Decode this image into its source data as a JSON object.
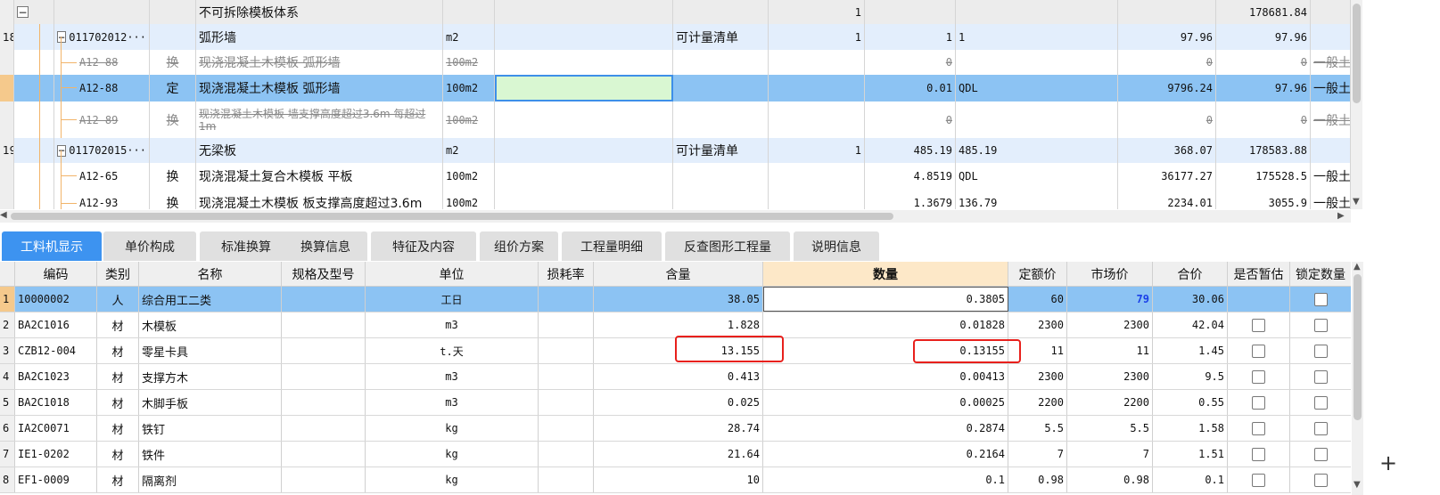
{
  "upper": {
    "rows": [
      {
        "no": "",
        "code": "",
        "code_tree": "minus",
        "type": "",
        "name": "不可拆除模板体系",
        "unit": "",
        "main_label": "",
        "fdl": "1",
        "qty1": "",
        "qty2": "",
        "price": "",
        "total": "178681.84",
        "kind": "",
        "style": "parent",
        "strike": false
      },
      {
        "no": "18",
        "code": "011702012···",
        "code_tree": "minus",
        "type": "",
        "name": "弧形墙",
        "unit": "m2",
        "main_label": "可计量清单",
        "fdl": "1",
        "qty1": "1",
        "qty2": "1",
        "price": "97.96",
        "total": "97.96",
        "kind": "",
        "style": "parent",
        "strike": false
      },
      {
        "no": "",
        "code": "A12-88",
        "code_tree": "",
        "type": "换",
        "name": "现浇混凝土木模板 弧形墙",
        "unit": "100m2",
        "main_label": "",
        "fdl": "",
        "qty1": "0",
        "qty2": "",
        "price": "0",
        "total": "0",
        "kind": "一般土",
        "style": "normal",
        "strike": true
      },
      {
        "no": "",
        "code": "A12-88",
        "code_tree": "",
        "type": "定",
        "name": "现浇混凝土木模板 弧形墙",
        "unit": "100m2",
        "main_label": "",
        "fdl": "",
        "qty1": "0.01",
        "qty2": "QDL",
        "price": "9796.24",
        "total": "97.96",
        "kind": "一般土",
        "style": "selected",
        "strike": false
      },
      {
        "no": "",
        "code": "A12-89",
        "code_tree": "",
        "type": "换",
        "name": "现浇混凝土木模板 墙支撑高度超过3.6m 每超过1m",
        "unit": "100m2",
        "main_label": "",
        "fdl": "",
        "qty1": "0",
        "qty2": "",
        "price": "0",
        "total": "0",
        "kind": "一般土",
        "style": "normal",
        "strike": true
      },
      {
        "no": "19",
        "code": "011702015···",
        "code_tree": "minus",
        "type": "",
        "name": "无梁板",
        "unit": "m2",
        "main_label": "可计量清单",
        "fdl": "1",
        "qty1": "485.19",
        "qty2": "485.19",
        "price": "368.07",
        "total": "178583.88",
        "kind": "",
        "style": "parent",
        "strike": false
      },
      {
        "no": "",
        "code": "A12-65",
        "code_tree": "",
        "type": "换",
        "name": "现浇混凝土复合木模板 平板",
        "unit": "100m2",
        "main_label": "",
        "fdl": "",
        "qty1": "4.8519",
        "qty2": "QDL",
        "price": "36177.27",
        "total": "175528.5",
        "kind": "一般土",
        "style": "normal",
        "strike": false
      },
      {
        "no": "",
        "code": "A12-93",
        "code_tree": "",
        "type": "换",
        "name": "现浇混凝土木模板 板支撑高度超过3.6m",
        "unit": "100m2",
        "main_label": "",
        "fdl": "",
        "qty1": "1.3679",
        "qty2": "136.79",
        "price": "2234.01",
        "total": "3055.9",
        "kind": "一般土",
        "style": "normal",
        "strike": false
      }
    ]
  },
  "tabs": [
    "工料机显示",
    "单价构成",
    "标准换算",
    "换算信息",
    "特征及内容",
    "组价方案",
    "工程量明细",
    "反查图形工程量",
    "说明信息"
  ],
  "active_tab": "工料机显示",
  "lower": {
    "headers": [
      "编码",
      "类别",
      "名称",
      "规格及型号",
      "单位",
      "损耗率",
      "含量",
      "数量",
      "定额价",
      "市场价",
      "合价",
      "是否暂估",
      "锁定数量"
    ],
    "rows": [
      {
        "no": "1",
        "code": "10000002",
        "cat": "人",
        "name": "综合用工二类",
        "spec": "",
        "unit": "工日",
        "loss": "",
        "content": "38.05",
        "qty": "0.3805",
        "quota": "60",
        "market": "79",
        "sum": "30.06",
        "est": false,
        "lock": false
      },
      {
        "no": "2",
        "code": "BA2C1016",
        "cat": "材",
        "name": "木模板",
        "spec": "",
        "unit": "m3",
        "loss": "",
        "content": "1.828",
        "qty": "0.01828",
        "quota": "2300",
        "market": "2300",
        "sum": "42.04",
        "est": false,
        "lock": false
      },
      {
        "no": "3",
        "code": "CZB12-004",
        "cat": "材",
        "name": "零星卡具",
        "spec": "",
        "unit": "t.天",
        "loss": "",
        "content": "13.155",
        "qty": "0.13155",
        "quota": "11",
        "market": "11",
        "sum": "1.45",
        "est": false,
        "lock": false
      },
      {
        "no": "4",
        "code": "BA2C1023",
        "cat": "材",
        "name": "支撑方木",
        "spec": "",
        "unit": "m3",
        "loss": "",
        "content": "0.413",
        "qty": "0.00413",
        "quota": "2300",
        "market": "2300",
        "sum": "9.5",
        "est": false,
        "lock": false
      },
      {
        "no": "5",
        "code": "BA2C1018",
        "cat": "材",
        "name": "木脚手板",
        "spec": "",
        "unit": "m3",
        "loss": "",
        "content": "0.025",
        "qty": "0.00025",
        "quota": "2200",
        "market": "2200",
        "sum": "0.55",
        "est": false,
        "lock": false
      },
      {
        "no": "6",
        "code": "IA2C0071",
        "cat": "材",
        "name": "铁钉",
        "spec": "",
        "unit": "kg",
        "loss": "",
        "content": "28.74",
        "qty": "0.2874",
        "quota": "5.5",
        "market": "5.5",
        "sum": "1.58",
        "est": false,
        "lock": false
      },
      {
        "no": "7",
        "code": "IE1-0202",
        "cat": "材",
        "name": "铁件",
        "spec": "",
        "unit": "kg",
        "loss": "",
        "content": "21.64",
        "qty": "0.2164",
        "quota": "7",
        "market": "7",
        "sum": "1.51",
        "est": false,
        "lock": false
      },
      {
        "no": "8",
        "code": "EF1-0009",
        "cat": "材",
        "name": "隔离剂",
        "spec": "",
        "unit": "kg",
        "loss": "",
        "content": "10",
        "qty": "0.1",
        "quota": "0.98",
        "market": "0.98",
        "sum": "0.1",
        "est": false,
        "lock": false
      }
    ]
  },
  "side": {
    "plus_label": "+"
  },
  "colors": {
    "selected_row": "#8cc3f3",
    "parent_row": "#e3eefc",
    "tab_active": "#3d93f0",
    "market_highlight": "#1a3fe8",
    "qty_header": "#fde8c8",
    "red_box": "#e8201c"
  }
}
